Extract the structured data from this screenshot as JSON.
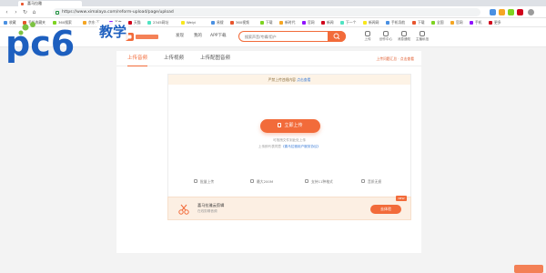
{
  "browser": {
    "tab_title": "喜马拉雅",
    "url": "https://www.ximalaya.com/reform-upload/page/upload",
    "bookmarks": [
      "收藏",
      "手机收藏夹",
      "360搜索",
      "京东·下",
      "百度",
      "天猫",
      "2345网址",
      "Weiyi",
      "易搜",
      "360视频",
      "下载",
      "新时代",
      "官网",
      "新闻",
      "下一个",
      "新闻网",
      "手机导航",
      "下载",
      "全国",
      "官网",
      "手机",
      "更多"
    ]
  },
  "header": {
    "nav": [
      "发现",
      "我的",
      "APP下载"
    ],
    "search_placeholder": "搜索声音/专辑/用户",
    "icons": [
      {
        "label": "上传",
        "icon": "upload-icon"
      },
      {
        "label": "创作中心",
        "icon": "creator-icon"
      },
      {
        "label": "消息通知",
        "icon": "bell-icon"
      },
      {
        "label": "主播私信",
        "icon": "message-icon"
      }
    ]
  },
  "watermark": {
    "brand": "pc6",
    "badge": "教学"
  },
  "content": {
    "tabs": [
      {
        "label": "上传音频",
        "active": true
      },
      {
        "label": "上传视频",
        "active": false
      },
      {
        "label": "上传配图音频",
        "active": false
      }
    ],
    "tabs_tip": "上传问题汇总 · 点击查看",
    "notice": {
      "text": "严禁上传违规内容",
      "link": "点击查看"
    },
    "upload_button": "立即上传",
    "hint_line1": "可拖拽文件到此处上传",
    "hint_line2_text": "上传即代表同意",
    "hint_line2_link": "《喜马拉雅用户服务协议》",
    "features": [
      {
        "label": "批量上传",
        "icon": "batch-icon"
      },
      {
        "label": "最大200M",
        "icon": "size-icon"
      },
      {
        "label": "支持11种格式",
        "icon": "format-icon"
      },
      {
        "label": "音质无损",
        "icon": "quality-icon"
      }
    ],
    "banner": {
      "title": "喜马拉雅云剪辑",
      "subtitle": "在线剪辑音频",
      "tag": "NEW",
      "button": "去体验"
    }
  },
  "colors": {
    "accent": "#f26b3a",
    "link": "#3b7cd6",
    "notice_bg": "#fdf3e6",
    "pc6_blue": "#1d5fbf",
    "pc6_green": "#7cc242"
  }
}
